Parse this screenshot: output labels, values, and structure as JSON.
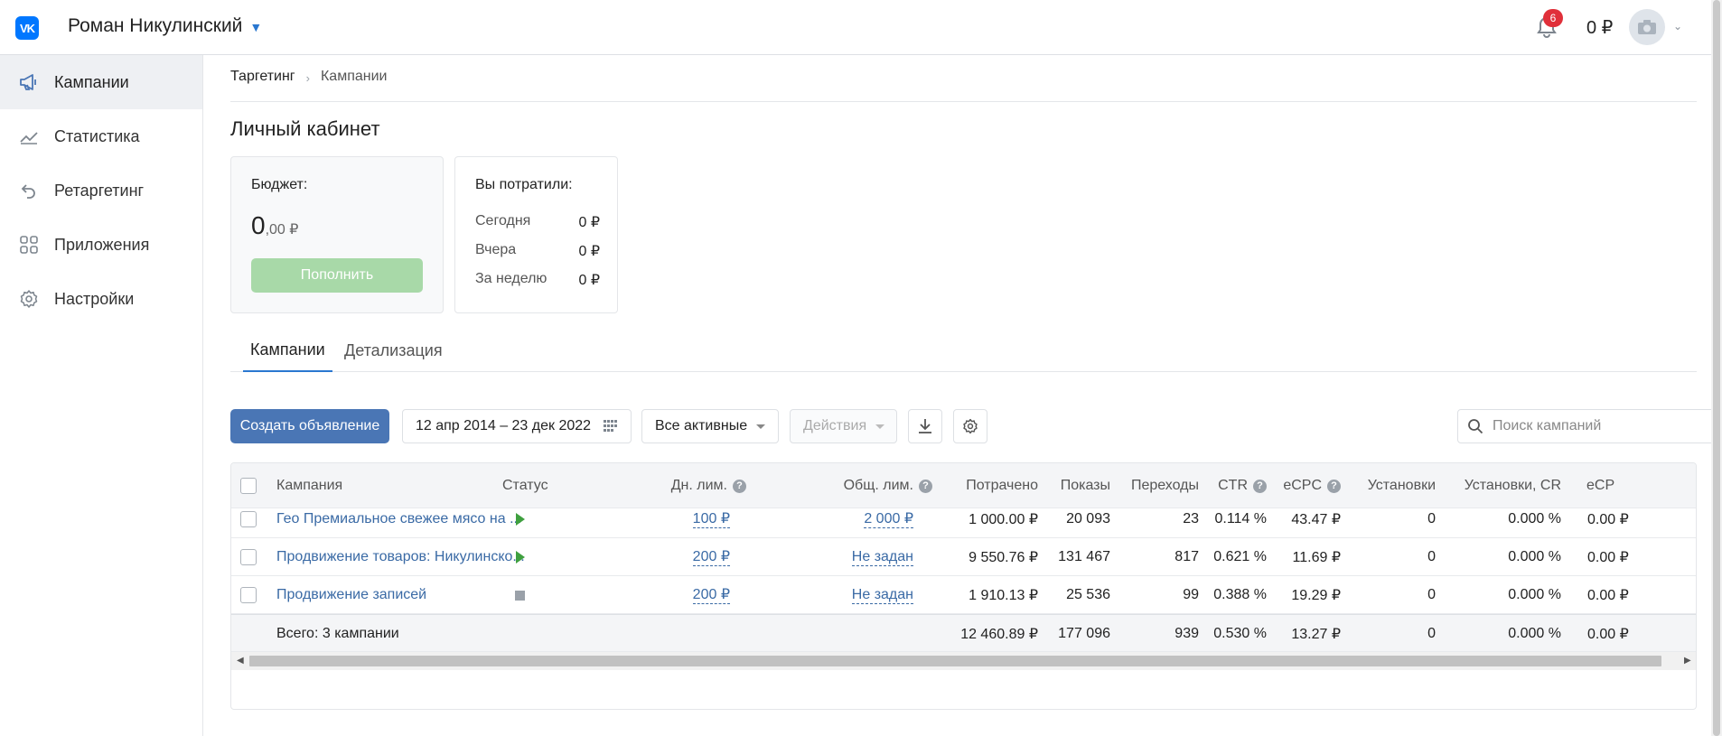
{
  "header": {
    "logo_text": "VK",
    "user_name": "Роман Никулинский",
    "notifications_count": "6",
    "balance": "0 ₽"
  },
  "sidebar": {
    "items": [
      {
        "label": "Кампании",
        "icon": "megaphone-icon",
        "active": true
      },
      {
        "label": "Статистика",
        "icon": "trend-chart-icon",
        "active": false
      },
      {
        "label": "Ретаргетинг",
        "icon": "undo-arrow-icon",
        "active": false
      },
      {
        "label": "Приложения",
        "icon": "apps-grid-icon",
        "active": false
      },
      {
        "label": "Настройки",
        "icon": "gear-icon",
        "active": false
      }
    ]
  },
  "breadcrumb": {
    "root": "Таргетинг",
    "current": "Кампании"
  },
  "page_title": "Личный кабинет",
  "budget": {
    "label": "Бюджет:",
    "amount_int": "0",
    "amount_frac": ",00 ₽",
    "topup_label": "Пополнить"
  },
  "spent": {
    "label": "Вы потратили:",
    "rows": [
      {
        "period": "Сегодня",
        "value": "0 ₽"
      },
      {
        "period": "Вчера",
        "value": "0 ₽"
      },
      {
        "period": "За неделю",
        "value": "0 ₽"
      }
    ]
  },
  "tabs": [
    {
      "label": "Кампании",
      "active": true
    },
    {
      "label": "Детализация",
      "active": false
    }
  ],
  "toolbar": {
    "create_label": "Создать объявление",
    "date_range": "12 апр 2014 – 23 дек 2022",
    "filter_label": "Все активные",
    "actions_label": "Действия",
    "search_placeholder": "Поиск кампаний"
  },
  "table": {
    "columns": {
      "campaign": "Кампания",
      "status": "Статус",
      "day_limit": "Дн. лим.",
      "total_limit": "Общ. лим.",
      "spent": "Потрачено",
      "impressions": "Показы",
      "clicks": "Переходы",
      "ctr": "CTR",
      "ecpc": "eCPC",
      "installs": "Установки",
      "installs_cr": "Установки, CR",
      "ecpi": "eCP"
    },
    "rows": [
      {
        "campaign": "Гео Премиальное свежее мясо на ...",
        "status": "running",
        "day_limit": "100 ₽",
        "total_limit": "2 000 ₽",
        "spent": "1 000.00 ₽",
        "impressions": "20 093",
        "clicks": "23",
        "ctr": "0.114 %",
        "ecpc": "43.47 ₽",
        "installs": "0",
        "installs_cr": "0.000 %",
        "ecpi": "0.00 ₽"
      },
      {
        "campaign": "Продвижение товаров: Никулинско...",
        "status": "running",
        "day_limit": "200 ₽",
        "total_limit": "Не задан",
        "spent": "9 550.76 ₽",
        "impressions": "131 467",
        "clicks": "817",
        "ctr": "0.621 %",
        "ecpc": "11.69 ₽",
        "installs": "0",
        "installs_cr": "0.000 %",
        "ecpi": "0.00 ₽"
      },
      {
        "campaign": "Продвижение записей",
        "status": "stopped",
        "day_limit": "200 ₽",
        "total_limit": "Не задан",
        "spent": "1 910.13 ₽",
        "impressions": "25 536",
        "clicks": "99",
        "ctr": "0.388 %",
        "ecpc": "19.29 ₽",
        "installs": "0",
        "installs_cr": "0.000 %",
        "ecpi": "0.00 ₽"
      }
    ],
    "total": {
      "label": "Всего: 3 кампании",
      "spent": "12 460.89 ₽",
      "impressions": "177 096",
      "clicks": "939",
      "ctr": "0.530 %",
      "ecpc": "13.27 ₽",
      "installs": "0",
      "installs_cr": "0.000 %",
      "ecpi": "0.00 ₽"
    }
  },
  "colors": {
    "accent": "#2a77d0",
    "primary_button": "#4a76b5",
    "topup_button": "#a8d9a8",
    "running": "#3fa03f",
    "badge": "#e0303a"
  }
}
